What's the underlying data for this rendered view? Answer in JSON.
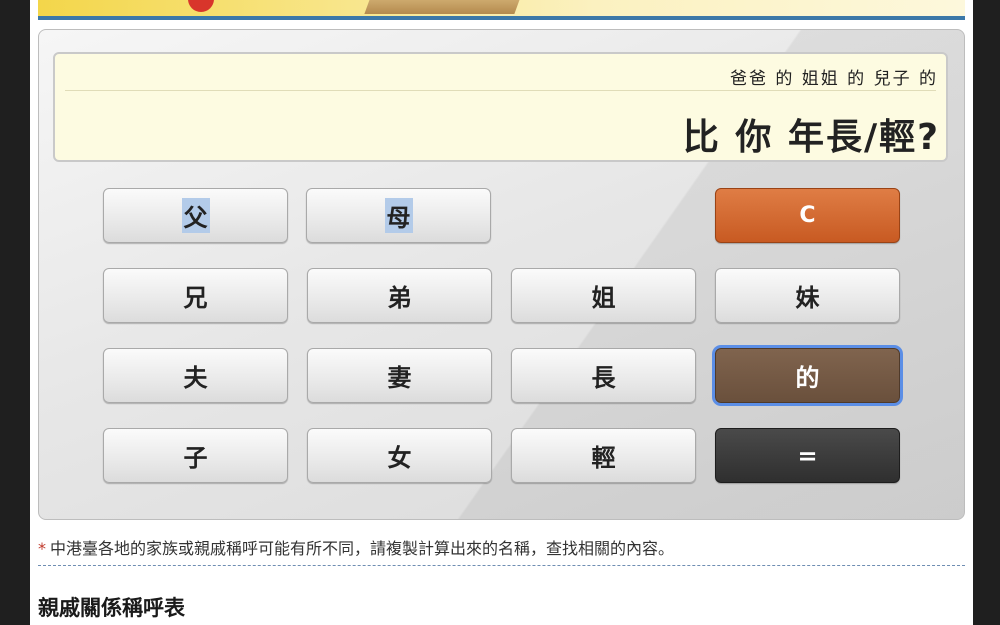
{
  "display": {
    "expression": "爸爸 的 姐姐 的 兒子 的",
    "result": "比 你 年長/輕?"
  },
  "keys": {
    "father": "父",
    "mother": "母",
    "clear": "C",
    "elder_brother": "兄",
    "younger_brother": "弟",
    "elder_sister": "姐",
    "younger_sister": "妹",
    "husband": "夫",
    "wife": "妻",
    "older": "長",
    "of": "的",
    "son": "子",
    "daughter": "女",
    "younger": "輕",
    "equals": "="
  },
  "note": {
    "marker": "*",
    "text": "中港臺各地的家族或親戚稱呼可能有所不同，請複製計算出來的名稱，查找相關的內容。"
  },
  "section": {
    "title": "親戚關係稱呼表"
  },
  "colors": {
    "clear_key": "#c85a22",
    "of_key": "#6a503c",
    "equals_key": "#2f2f2f",
    "display_bg": "#fdfbe1",
    "accent_rule": "#3c78a8"
  }
}
